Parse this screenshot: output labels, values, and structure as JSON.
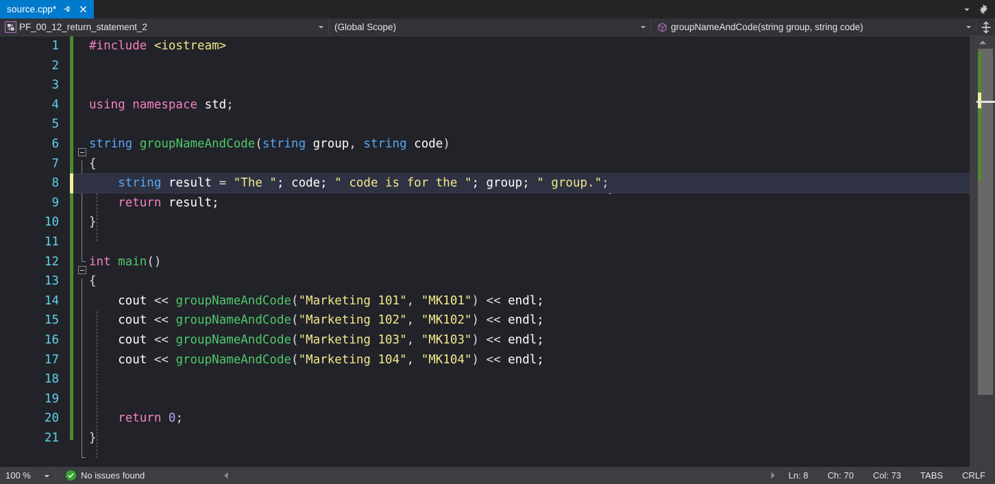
{
  "window": {
    "tabstrip_dropdown_icon": "chevron-down-icon",
    "tabstrip_gear_icon": "gear-icon"
  },
  "tab": {
    "title": "source.cpp*",
    "pin_icon": "pin-icon",
    "close_icon": "close-icon"
  },
  "navbar": {
    "project": "PF_00_12_return_statement_2",
    "project_icon": "project-icon",
    "scope": "(Global Scope)",
    "member": "groupNameAndCode(string group, string code)",
    "member_icon": "cube-icon",
    "dropdown_icon": "chevron-down-icon",
    "split_icon": "split-window-icon"
  },
  "editor": {
    "line_numbers": [
      "1",
      "2",
      "3",
      "4",
      "5",
      "6",
      "7",
      "8",
      "9",
      "10",
      "11",
      "12",
      "13",
      "14",
      "15",
      "16",
      "17",
      "18",
      "19",
      "20",
      "21"
    ],
    "lines": [
      {
        "n": 1,
        "tokens": [
          {
            "t": "#include ",
            "c": "k"
          },
          {
            "t": "<iostream>",
            "c": "str"
          }
        ]
      },
      {
        "n": 2,
        "tokens": []
      },
      {
        "n": 3,
        "tokens": []
      },
      {
        "n": 4,
        "tokens": [
          {
            "t": "using namespace ",
            "c": "k"
          },
          {
            "t": "std",
            "c": "id"
          },
          {
            "t": ";",
            "c": "pun"
          }
        ]
      },
      {
        "n": 5,
        "tokens": []
      },
      {
        "n": 6,
        "tokens": [
          {
            "t": "string",
            "c": "typ"
          },
          {
            "t": " ",
            "c": "pun"
          },
          {
            "t": "groupNameAndCode",
            "c": "fn"
          },
          {
            "t": "(",
            "c": "pun"
          },
          {
            "t": "string",
            "c": "typ"
          },
          {
            "t": " group",
            "c": "id"
          },
          {
            "t": ", ",
            "c": "pun"
          },
          {
            "t": "string",
            "c": "typ"
          },
          {
            "t": " code",
            "c": "id"
          },
          {
            "t": ")",
            "c": "pun"
          }
        ]
      },
      {
        "n": 7,
        "tokens": [
          {
            "t": "{",
            "c": "pun"
          }
        ]
      },
      {
        "n": 8,
        "tokens": [
          {
            "t": "    ",
            "c": "pun"
          },
          {
            "t": "string",
            "c": "typ"
          },
          {
            "t": " result ",
            "c": "id"
          },
          {
            "t": "= ",
            "c": "op"
          },
          {
            "t": "\"The \"",
            "c": "str"
          },
          {
            "t": "; code; ",
            "c": "id"
          },
          {
            "t": "\" code is for the \"",
            "c": "str"
          },
          {
            "t": "; group; ",
            "c": "id"
          },
          {
            "t": "\" group.\"",
            "c": "str"
          },
          {
            "t": ";",
            "c": "pun"
          }
        ]
      },
      {
        "n": 9,
        "tokens": [
          {
            "t": "    ",
            "c": "pun"
          },
          {
            "t": "return",
            "c": "k"
          },
          {
            "t": " result;",
            "c": "id"
          }
        ]
      },
      {
        "n": 10,
        "tokens": [
          {
            "t": "}",
            "c": "pun"
          }
        ]
      },
      {
        "n": 11,
        "tokens": []
      },
      {
        "n": 12,
        "tokens": [
          {
            "t": "int",
            "c": "k"
          },
          {
            "t": " ",
            "c": "pun"
          },
          {
            "t": "main",
            "c": "fn"
          },
          {
            "t": "()",
            "c": "pun"
          }
        ]
      },
      {
        "n": 13,
        "tokens": [
          {
            "t": "{",
            "c": "pun"
          }
        ]
      },
      {
        "n": 14,
        "tokens": [
          {
            "t": "    cout ",
            "c": "id"
          },
          {
            "t": "<< ",
            "c": "op"
          },
          {
            "t": "groupNameAndCode",
            "c": "fn"
          },
          {
            "t": "(",
            "c": "pun"
          },
          {
            "t": "\"Marketing 101\"",
            "c": "str"
          },
          {
            "t": ", ",
            "c": "pun"
          },
          {
            "t": "\"MK101\"",
            "c": "str"
          },
          {
            "t": ") ",
            "c": "pun"
          },
          {
            "t": "<< ",
            "c": "op"
          },
          {
            "t": "endl;",
            "c": "id"
          }
        ]
      },
      {
        "n": 15,
        "tokens": [
          {
            "t": "    cout ",
            "c": "id"
          },
          {
            "t": "<< ",
            "c": "op"
          },
          {
            "t": "groupNameAndCode",
            "c": "fn"
          },
          {
            "t": "(",
            "c": "pun"
          },
          {
            "t": "\"Marketing 102\"",
            "c": "str"
          },
          {
            "t": ", ",
            "c": "pun"
          },
          {
            "t": "\"MK102\"",
            "c": "str"
          },
          {
            "t": ") ",
            "c": "pun"
          },
          {
            "t": "<< ",
            "c": "op"
          },
          {
            "t": "endl;",
            "c": "id"
          }
        ]
      },
      {
        "n": 16,
        "tokens": [
          {
            "t": "    cout ",
            "c": "id"
          },
          {
            "t": "<< ",
            "c": "op"
          },
          {
            "t": "groupNameAndCode",
            "c": "fn"
          },
          {
            "t": "(",
            "c": "pun"
          },
          {
            "t": "\"Marketing 103\"",
            "c": "str"
          },
          {
            "t": ", ",
            "c": "pun"
          },
          {
            "t": "\"MK103\"",
            "c": "str"
          },
          {
            "t": ") ",
            "c": "pun"
          },
          {
            "t": "<< ",
            "c": "op"
          },
          {
            "t": "endl;",
            "c": "id"
          }
        ]
      },
      {
        "n": 17,
        "tokens": [
          {
            "t": "    cout ",
            "c": "id"
          },
          {
            "t": "<< ",
            "c": "op"
          },
          {
            "t": "groupNameAndCode",
            "c": "fn"
          },
          {
            "t": "(",
            "c": "pun"
          },
          {
            "t": "\"Marketing 104\"",
            "c": "str"
          },
          {
            "t": ", ",
            "c": "pun"
          },
          {
            "t": "\"MK104\"",
            "c": "str"
          },
          {
            "t": ") ",
            "c": "pun"
          },
          {
            "t": "<< ",
            "c": "op"
          },
          {
            "t": "endl;",
            "c": "id"
          }
        ]
      },
      {
        "n": 18,
        "tokens": []
      },
      {
        "n": 19,
        "tokens": []
      },
      {
        "n": 20,
        "tokens": [
          {
            "t": "    ",
            "c": "pun"
          },
          {
            "t": "return",
            "c": "k"
          },
          {
            "t": " ",
            "c": "pun"
          },
          {
            "t": "0",
            "c": "num"
          },
          {
            "t": ";",
            "c": "pun"
          }
        ]
      },
      {
        "n": 21,
        "tokens": [
          {
            "t": "}",
            "c": "pun"
          }
        ]
      }
    ],
    "current_line": 8,
    "colors": {
      "background": "#222229",
      "current_line_bg": "#2f3242",
      "line_number": "#5fd3e8",
      "keyword": "#f481c1",
      "type": "#56a8f5",
      "function": "#4ec96a",
      "string": "#f2e98b",
      "number": "#b9a5f2",
      "text": "#dcdcdc",
      "changebar_saved": "#4f8a2e",
      "changebar_edited": "#f0f0a0",
      "tab_active": "#007acc"
    }
  },
  "statusbar": {
    "zoom": "100 %",
    "zoom_arrow_icon": "chevron-down-icon",
    "issues_icon": "check-circle-icon",
    "issues": "No issues found",
    "hscroll_left_icon": "triangle-left-icon",
    "hscroll_right_icon": "triangle-right-icon",
    "line": "Ln: 8",
    "char": "Ch: 70",
    "col": "Col: 73",
    "tabs_mode": "TABS",
    "line_endings": "CRLF"
  }
}
